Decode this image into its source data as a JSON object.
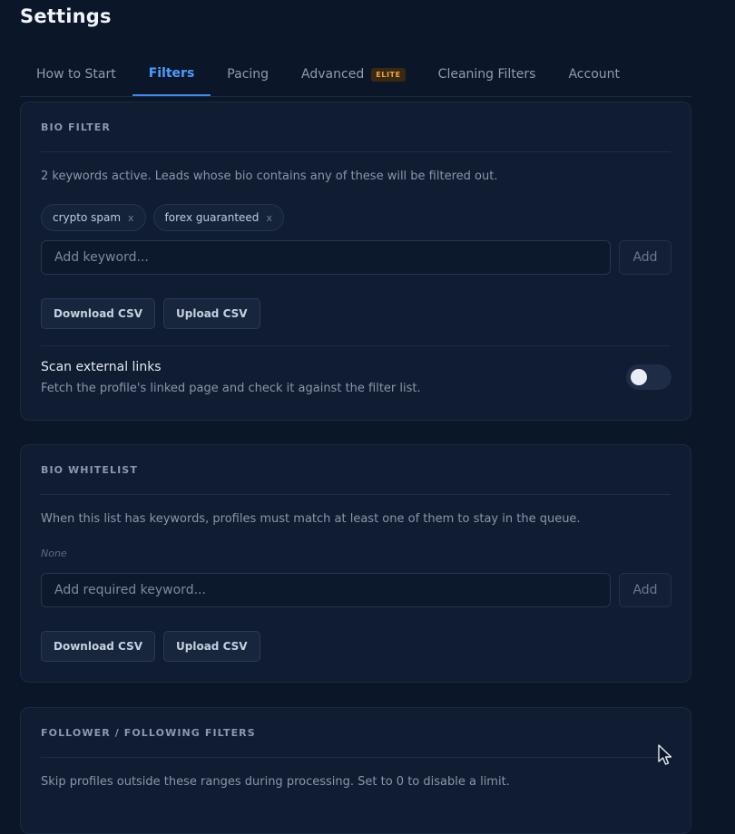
{
  "page": {
    "title": "Settings"
  },
  "tabs": [
    {
      "label": "How to Start"
    },
    {
      "label": "Filters",
      "active": true
    },
    {
      "label": "Pacing"
    },
    {
      "label": "Advanced",
      "badge": "ELITE"
    },
    {
      "label": "Cleaning Filters"
    },
    {
      "label": "Account"
    }
  ],
  "bio_filter": {
    "heading": "BIO FILTER",
    "description": "2 keywords active. Leads whose bio contains any of these will be filtered out.",
    "keywords": [
      {
        "label": "crypto spam",
        "remove": "x"
      },
      {
        "label": "forex guaranteed",
        "remove": "x"
      }
    ],
    "input_placeholder": "Add keyword...",
    "add_label": "Add",
    "download_label": "Download CSV",
    "upload_label": "Upload CSV",
    "scan_links": {
      "title": "Scan external links",
      "description": "Fetch the profile's linked page and check it against the filter list.",
      "enabled": false
    }
  },
  "bio_whitelist": {
    "heading": "BIO WHITELIST",
    "description": "When this list has keywords, profiles must match at least one of them to stay in the queue.",
    "empty_label": "None",
    "input_placeholder": "Add required keyword...",
    "add_label": "Add",
    "download_label": "Download CSV",
    "upload_label": "Upload CSV"
  },
  "follower_filters": {
    "heading": "FOLLOWER / FOLLOWING FILTERS",
    "description": "Skip profiles outside these ranges during processing. Set to 0 to disable a limit."
  },
  "theme": {
    "accent": "#3b8af0",
    "background": "#0b1628",
    "card": "#0f1c31",
    "badge_text": "#f0a53a"
  }
}
